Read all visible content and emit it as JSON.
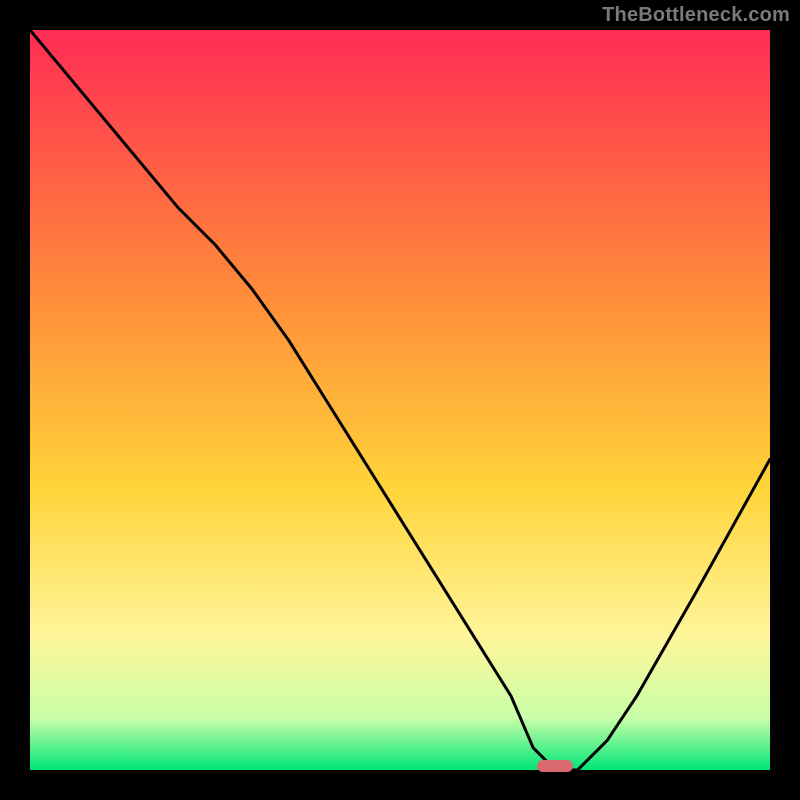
{
  "watermark": "TheBottleneck.com",
  "colors": {
    "top": "#ff2c54",
    "mid_upper": "#ff8a3a",
    "mid": "#ffd43a",
    "mid_lower": "#fff59a",
    "near_bottom": "#c8ffa8",
    "bottom": "#00e676",
    "marker": "#d9696f",
    "curve": "#000000",
    "border": "#000000"
  },
  "plot": {
    "x_range": [
      0,
      100
    ],
    "y_range": [
      0,
      100
    ],
    "marker_x": 71,
    "marker_y": 0
  },
  "chart_data": {
    "type": "line",
    "title": "",
    "xlabel": "",
    "ylabel": "",
    "xlim": [
      0,
      100
    ],
    "ylim": [
      0,
      100
    ],
    "series": [
      {
        "name": "bottleneck-curve",
        "x": [
          0,
          5,
          10,
          15,
          20,
          25,
          30,
          35,
          40,
          45,
          50,
          55,
          60,
          65,
          68,
          71,
          74,
          78,
          82,
          86,
          90,
          95,
          100
        ],
        "y": [
          100,
          94,
          88,
          82,
          76,
          71,
          65,
          58,
          50,
          42,
          34,
          26,
          18,
          10,
          3,
          0,
          0,
          4,
          10,
          17,
          24,
          33,
          42
        ]
      }
    ],
    "annotations": [
      {
        "type": "marker",
        "shape": "rounded-bar",
        "x": 71,
        "y": 0,
        "color": "#d9696f"
      }
    ],
    "background_gradient_stops": [
      {
        "pct": 0,
        "color": "#ff2c54"
      },
      {
        "pct": 35,
        "color": "#ff8a3a"
      },
      {
        "pct": 62,
        "color": "#ffd43a"
      },
      {
        "pct": 82,
        "color": "#fff59a"
      },
      {
        "pct": 93,
        "color": "#c8ffa8"
      },
      {
        "pct": 100,
        "color": "#00e676"
      }
    ]
  }
}
